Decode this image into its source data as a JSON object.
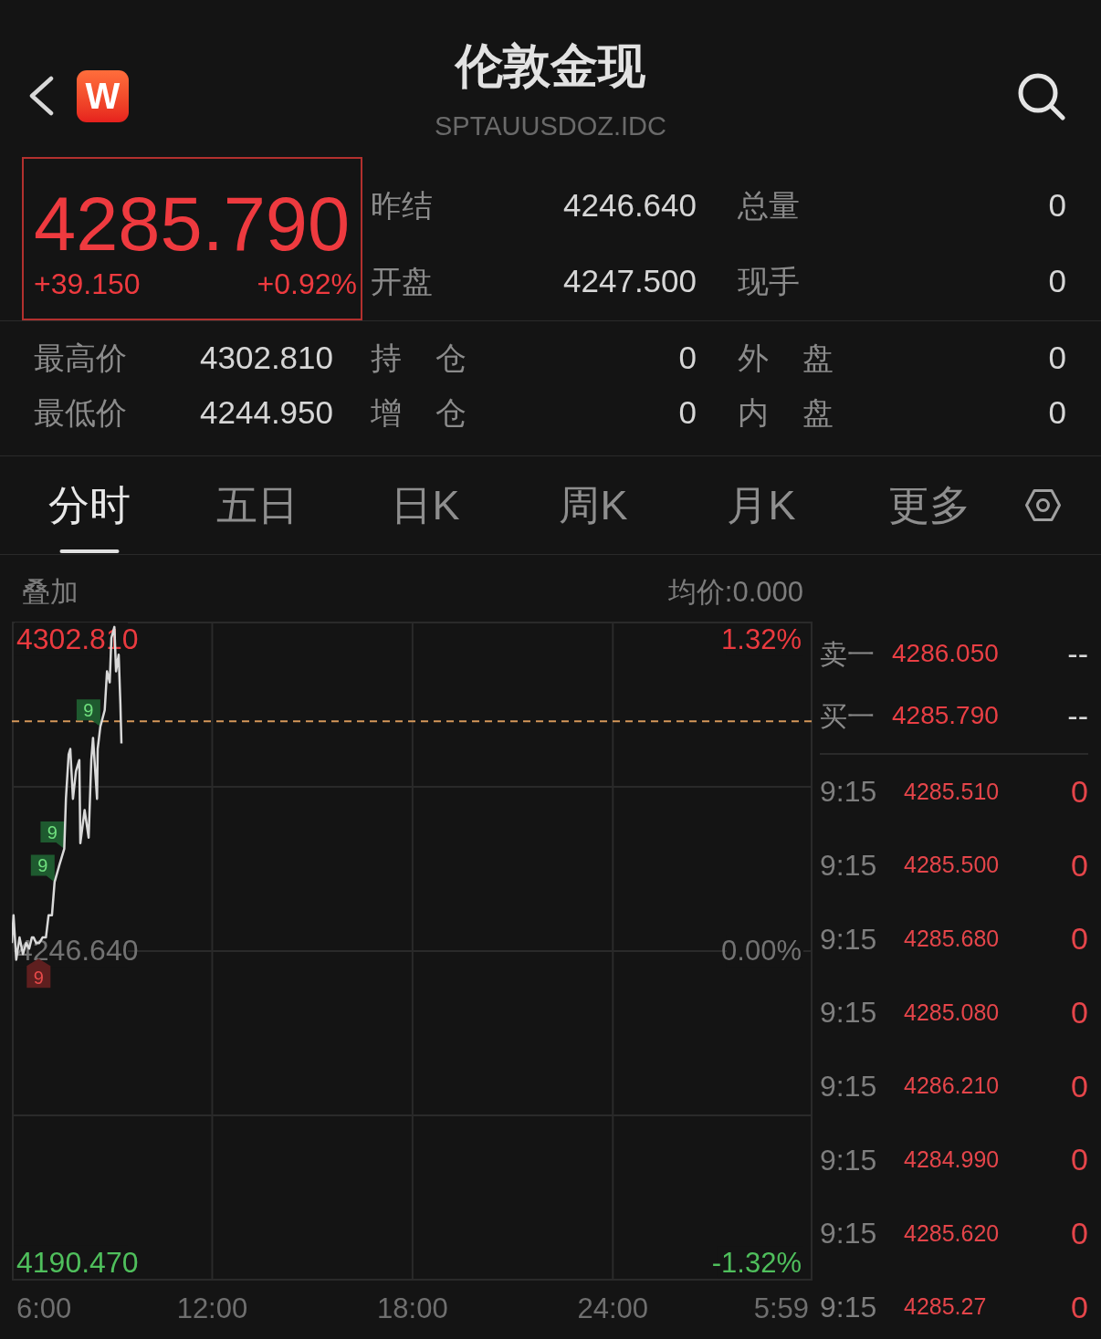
{
  "header": {
    "logo_text": "W",
    "title": "伦敦金现",
    "subtitle": "SPTAUUSDOZ.IDC"
  },
  "quote": {
    "price": "4285.790",
    "change": "+39.150",
    "change_percent": "+0.92%",
    "rising": true
  },
  "stats": {
    "upper_rows": [
      [
        {
          "label": "昨结",
          "value": "4246.640"
        },
        {
          "label": "总量",
          "value": "0"
        }
      ],
      [
        {
          "label": "开盘",
          "value": "4247.500"
        },
        {
          "label": "现手",
          "value": "0"
        }
      ]
    ],
    "lower_rows": [
      [
        {
          "label": "最高价",
          "value": "4302.810"
        },
        {
          "label": "持 仓",
          "value": "0"
        },
        {
          "label": "外 盘",
          "value": "0"
        }
      ],
      [
        {
          "label": "最低价",
          "value": "4244.950"
        },
        {
          "label": "增 仓",
          "value": "0"
        },
        {
          "label": "内 盘",
          "value": "0"
        }
      ]
    ]
  },
  "tabs": [
    {
      "label": "分时",
      "selected": true
    },
    {
      "label": "五日",
      "selected": false
    },
    {
      "label": "日K",
      "selected": false
    },
    {
      "label": "周K",
      "selected": false
    },
    {
      "label": "月K",
      "selected": false
    },
    {
      "label": "更多",
      "selected": false
    }
  ],
  "chart_toolbar": {
    "overlay": "叠加",
    "average_price": "均价:0.000"
  },
  "chart": {
    "percent_labels": [
      {
        "text": "1.32%",
        "color": "#ea3a3f"
      },
      {
        "text": "0.00%",
        "color": "#727272"
      },
      {
        "text": "-1.32%",
        "color": "#4fbf5c"
      }
    ],
    "axis_end_label": "5:59",
    "markers": [
      {
        "kind": "above",
        "color": "#1e5a2f"
      },
      {
        "kind": "above",
        "color": "#1e5a2f"
      },
      {
        "kind": "above",
        "color": "#1e5a2f"
      },
      {
        "kind": "below",
        "color": "#5e1f1f"
      }
    ],
    "chart_data": {
      "type": "line",
      "grid": true,
      "x": [
        6,
        6.05,
        6.13,
        6.23,
        6.33,
        6.43,
        6.52,
        6.6,
        6.65,
        6.73,
        6.82,
        6.92,
        7.02,
        7.1,
        7.2,
        7.28,
        7.42,
        7.57,
        7.62,
        7.7,
        7.75,
        7.83,
        7.92,
        8.02,
        8.05,
        8.18,
        8.3,
        8.38,
        8.43,
        8.55,
        8.57,
        8.65,
        8.78,
        8.85,
        8.93,
        8.98,
        9.07,
        9.12,
        9.2,
        9.25,
        9.28
      ],
      "series": [
        {
          "color": "#d9d9d9",
          "values": [
            4248,
            4253,
            4245,
            4249,
            4246,
            4248,
            4247,
            4249,
            4249,
            4248,
            4248,
            4249,
            4249,
            4253,
            4253,
            4259,
            4262,
            4265,
            4274,
            4282,
            4283,
            4274,
            4279,
            4281,
            4266,
            4272,
            4267,
            4281,
            4285,
            4274,
            4283,
            4287,
            4290,
            4297,
            4295,
            4303,
            4305,
            4297,
            4300,
            4291,
            4284
          ]
        }
      ],
      "xlim": [
        6,
        29.98
      ],
      "ylim": [
        4187.3,
        4305.8
      ],
      "xticks": [
        {
          "value": 6,
          "label": "6:00"
        },
        {
          "value": 12,
          "label": "12:00"
        },
        {
          "value": 18,
          "label": "18:00"
        },
        {
          "value": 24,
          "label": "24:00"
        }
      ],
      "yticks": [
        {
          "value": 4302.81,
          "label": "4302.810"
        },
        {
          "value": 4246.64,
          "label": "4246.640"
        },
        {
          "value": 4190.47,
          "label": "4190.470"
        }
      ],
      "ref_lines": [
        {
          "axis": "y",
          "value": 4288
        }
      ],
      "annotations": [
        {
          "text": "9",
          "x": 8.65,
          "y": 4287
        },
        {
          "text": "9",
          "x": 7.57,
          "y": 4265
        },
        {
          "text": "9",
          "x": 7.28,
          "y": 4259
        },
        {
          "text": "9",
          "x": 6.8,
          "y": 4248
        }
      ]
    }
  },
  "order_book": {
    "quotes": [
      {
        "label": "卖一",
        "price": "4286.050",
        "volume": "--"
      },
      {
        "label": "买一",
        "price": "4285.790",
        "volume": "--"
      }
    ],
    "trades": [
      {
        "time": "9:15",
        "price": "4285.510",
        "volume": "0"
      },
      {
        "time": "9:15",
        "price": "4285.500",
        "volume": "0"
      },
      {
        "time": "9:15",
        "price": "4285.680",
        "volume": "0"
      },
      {
        "time": "9:15",
        "price": "4285.080",
        "volume": "0"
      },
      {
        "time": "9:15",
        "price": "4286.210",
        "volume": "0"
      },
      {
        "time": "9:15",
        "price": "4284.990",
        "volume": "0"
      },
      {
        "time": "9:15",
        "price": "4285.620",
        "volume": "0"
      },
      {
        "time": "9:15",
        "price": "4285.27",
        "volume": "0"
      }
    ]
  }
}
